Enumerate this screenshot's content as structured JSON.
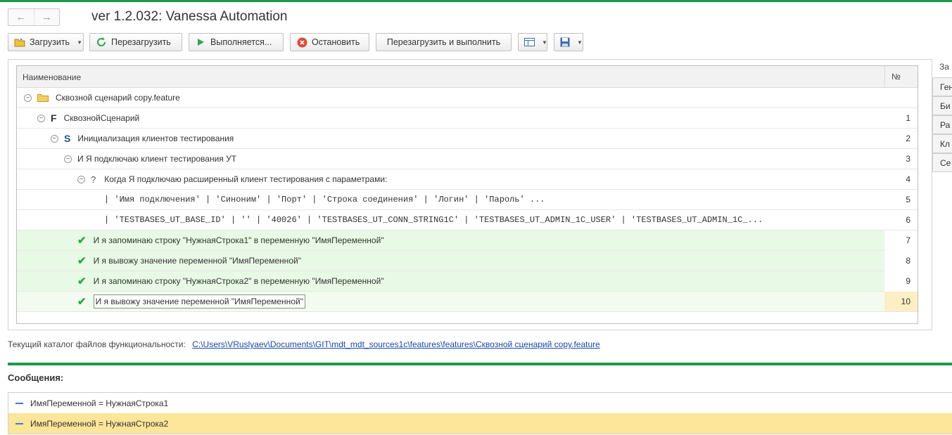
{
  "window": {
    "title": "ver 1.2.032: Vanessa Automation"
  },
  "toolbar": {
    "load": "Загрузить",
    "reload": "Перезагрузить",
    "running": "Выполняется...",
    "stop": "Остановить",
    "reload_run": "Перезагрузить и выполнить"
  },
  "tree": {
    "col_name": "Наименование",
    "col_num": "№",
    "rows": [
      {
        "text": "Сквозной сценарий copy.feature",
        "num": ""
      },
      {
        "text": "СквознойСценарий",
        "num": "1"
      },
      {
        "text": "Инициализация клиентов тестирования",
        "num": "2"
      },
      {
        "text": "И Я подключаю клиент тестирования УТ",
        "num": "3"
      },
      {
        "text": "Когда Я подключаю расширенный клиент тестирования с параметрами:",
        "num": "4"
      },
      {
        "text": "| 'Имя подключения'      | 'Синоним' | 'Порт'  | 'Строка соединения'         | 'Логин'                      | 'Пароль'            ...",
        "num": "5"
      },
      {
        "text": "| 'TESTBASES_UT_BASE_ID' | ''        | '40026' | 'TESTBASES_UT_CONN_STRING1C' | 'TESTBASES_UT_ADMIN_1C_USER' | 'TESTBASES_UT_ADMIN_1C_...",
        "num": "6"
      },
      {
        "text": "И я запоминаю строку \"НужнаяСтрока1\" в переменную \"ИмяПеременной\"",
        "num": "7"
      },
      {
        "text": "И я вывожу значение переменной \"ИмяПеременной\"",
        "num": "8"
      },
      {
        "text": "И я запоминаю строку \"НужнаяСтрока2\" в переменную \"ИмяПеременной\"",
        "num": "9"
      },
      {
        "text": "И я вывожу значение переменной \"ИмяПеременной\"",
        "num": "10"
      }
    ]
  },
  "side_panel": {
    "header": "За",
    "items": [
      "Ген",
      "Би",
      "Ра",
      "Кл",
      "Се"
    ]
  },
  "catalog": {
    "label": "Текущий каталог файлов функциональности:",
    "path": "C:\\Users\\VRuslyaev\\Documents\\GIT\\mdt_mdt_sources1c\\features\\features\\Сквозной сценарий copy.feature"
  },
  "messages": {
    "title": "Сообщения:",
    "items": [
      "ИмяПеременной = НужнаяСтрока1",
      "ИмяПеременной = НужнаяСтрока2"
    ]
  },
  "colors": {
    "accent": "#1c9a4a",
    "row_success": "#e8f9e5",
    "message_highlight": "#fde599",
    "link": "#1a4aa8"
  }
}
